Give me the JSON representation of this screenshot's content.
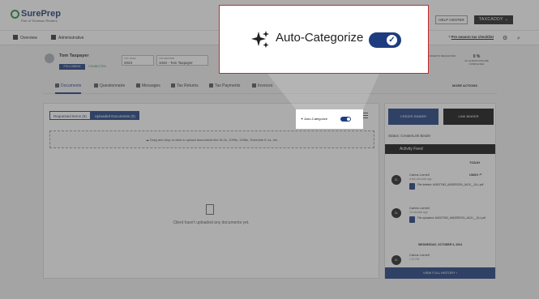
{
  "brand": {
    "name": "SurePrep",
    "subtitle": "Part of Thomson Reuters"
  },
  "header": {
    "help_label": "HELP CENTER",
    "product_label": "TAXCADDY"
  },
  "nav": {
    "overview": "Overview",
    "administrative": "Administrative",
    "checklist_prefix": "Pre season tax checklist"
  },
  "client": {
    "name": "Tom Taxpayer",
    "following": "FOLLOWING",
    "connected": "CONNECTED",
    "tax_year_label": "TAX YEAR",
    "tax_year": "2023",
    "tax_return_label": "TAX RETURN",
    "tax_return": "1040 - Tom Taxpayer",
    "stat1_value": "",
    "stat1_label": "DOCUMENTS REQUESTED",
    "stat2_value": "0 %",
    "stat2_label": "OF QUESTIONNAIRE COMPLETED"
  },
  "tabs": [
    "Documents",
    "Questionnaire",
    "Messages",
    "Tax Returns",
    "Tax Payments",
    "Invoices"
  ],
  "more_actions": "MORE ACTIONS",
  "documents": {
    "requested_tab": "Requested Items (9)",
    "uploaded_tab": "Uploaded Documents (0)",
    "auto_categorize_label": "Auto-Categorize",
    "auto_categorize_on": true,
    "drop_text": "Drag and drop or click to upload documents like W-2s, 1099s, 1098s, Schedule K-1s, etc.",
    "empty_text": "Client hasn't uploaded any documents yet."
  },
  "sidebar": {
    "create_binder": "CREATE BINDER",
    "link_binder": "LINK BINDER",
    "status": "Status: Create/Link Binder",
    "feed_title": "Activity Feed",
    "today": "TODAY",
    "entries": [
      {
        "initials": "CL",
        "who": "Carlos Lornell",
        "time": "a few seconds ago",
        "undo": "UNDO",
        "file": "File deleted: A0002TW2_ANDERSON_JACK__JILL.pdf"
      },
      {
        "initials": "CL",
        "who": "Carlos Lornell",
        "time": "10 minutes ago",
        "undo": "",
        "file": "File uploaded: A0002TW2_ANDERSON_JACK__JILL.pdf"
      },
      {
        "initials": "CL",
        "who": "Carlos Lornell",
        "time": "1:21 PM",
        "undo": "",
        "file": ""
      }
    ],
    "date_line": "WEDNESDAY, OCTOBER 9, 2024",
    "view_history": "VIEW FULL HISTORY"
  },
  "zoom": {
    "label": "Auto-Categorize",
    "toggle_on": true
  },
  "colors": {
    "navy": "#1e3d80",
    "callout_border": "#c62828",
    "brand_green": "#2e8b3f"
  }
}
